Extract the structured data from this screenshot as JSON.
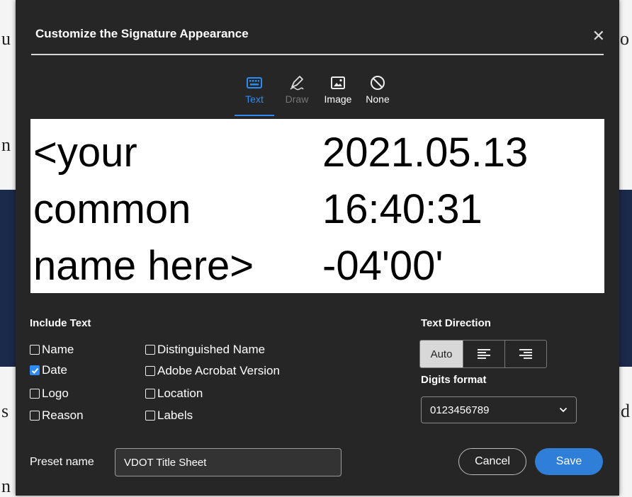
{
  "background": {
    "fragments": [
      "u",
      "n",
      "s",
      "n",
      "o",
      "d"
    ]
  },
  "dialog": {
    "title": "Customize the Signature Appearance",
    "close_glyph": "✕"
  },
  "tabs": [
    {
      "label": "Text",
      "icon": "keyboard-icon",
      "state": "active"
    },
    {
      "label": "Draw",
      "icon": "pen-draw-icon",
      "state": "disabled"
    },
    {
      "label": "Image",
      "icon": "image-icon",
      "state": "normal"
    },
    {
      "label": "None",
      "icon": "no-icon",
      "state": "normal"
    }
  ],
  "preview": {
    "name_text": "<your\ncommon\nname here>",
    "date_text": "2021.05.13\n16:40:31\n-04'00'"
  },
  "include_text": {
    "heading": "Include Text",
    "options": [
      {
        "label": "Name",
        "checked": false
      },
      {
        "label": "Date",
        "checked": true
      },
      {
        "label": "Logo",
        "checked": false
      },
      {
        "label": "Reason",
        "checked": false
      },
      {
        "label": "Distinguished Name",
        "checked": false
      },
      {
        "label": "Adobe Acrobat Version",
        "checked": false
      },
      {
        "label": "Location",
        "checked": false
      },
      {
        "label": "Labels",
        "checked": false
      }
    ]
  },
  "text_direction": {
    "heading": "Text Direction",
    "auto_label": "Auto",
    "selected": "Auto"
  },
  "digits_format": {
    "heading": "Digits format",
    "value": "0123456789"
  },
  "preset": {
    "label": "Preset name",
    "value": "VDOT Title Sheet"
  },
  "buttons": {
    "cancel": "Cancel",
    "save": "Save"
  },
  "colors": {
    "dialog_bg": "#262626",
    "accent": "#2e8cf0",
    "save_bg": "#2f7ed8"
  }
}
